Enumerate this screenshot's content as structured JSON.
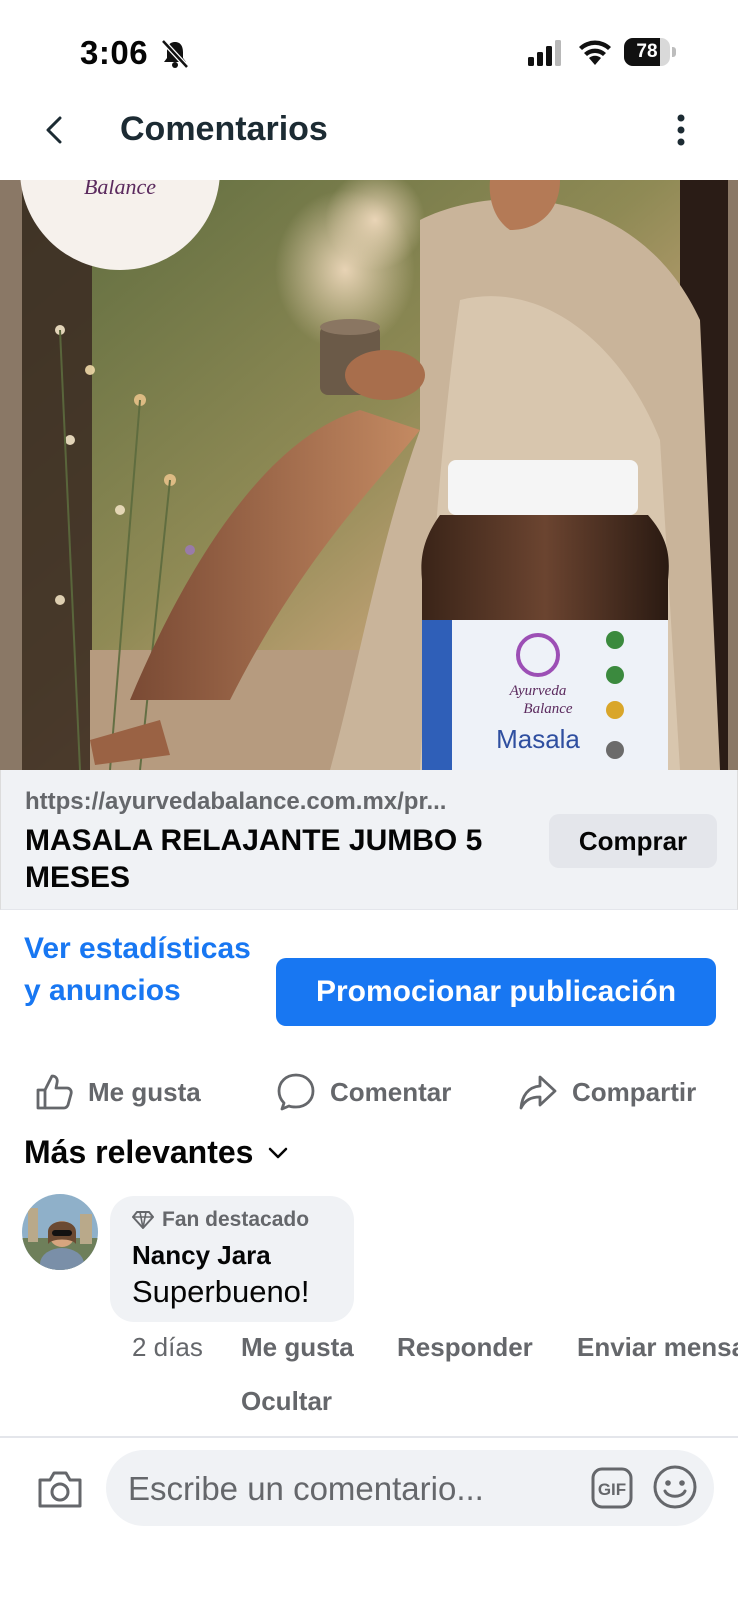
{
  "status_bar": {
    "time": "3:06",
    "battery_level": "78",
    "battery_fraction": 0.78
  },
  "header": {
    "title": "Comentarios"
  },
  "post": {
    "brand_text_top": "Balance",
    "jar_brand_line1": "Ayurveda",
    "jar_brand_line2": "Balance",
    "jar_label": "Masala"
  },
  "link_preview": {
    "url": "https://ayurvedabalance.com.mx/pr...",
    "title": "MASALA RELAJANTE JUMBO 5 MESES",
    "button_label": "Comprar"
  },
  "stats_link": "Ver estadísticas y anuncios",
  "promote_button": "Promocionar publicación",
  "actions": {
    "like": "Me gusta",
    "comment": "Comentar",
    "share": "Compartir"
  },
  "sort_label": "Más relevantes",
  "comment": {
    "badge": "Fan destacado",
    "author": "Nancy Jara",
    "text": "Superbueno!",
    "time": "2 días",
    "like": "Me gusta",
    "reply": "Responder",
    "send_message": "Enviar mensaje",
    "hide": "Ocultar"
  },
  "composer": {
    "placeholder": "Escribe un comentario...",
    "gif_label": "GIF"
  },
  "colors": {
    "accent": "#1877f2",
    "text_secondary": "#65676b",
    "surface": "#f0f2f5"
  }
}
